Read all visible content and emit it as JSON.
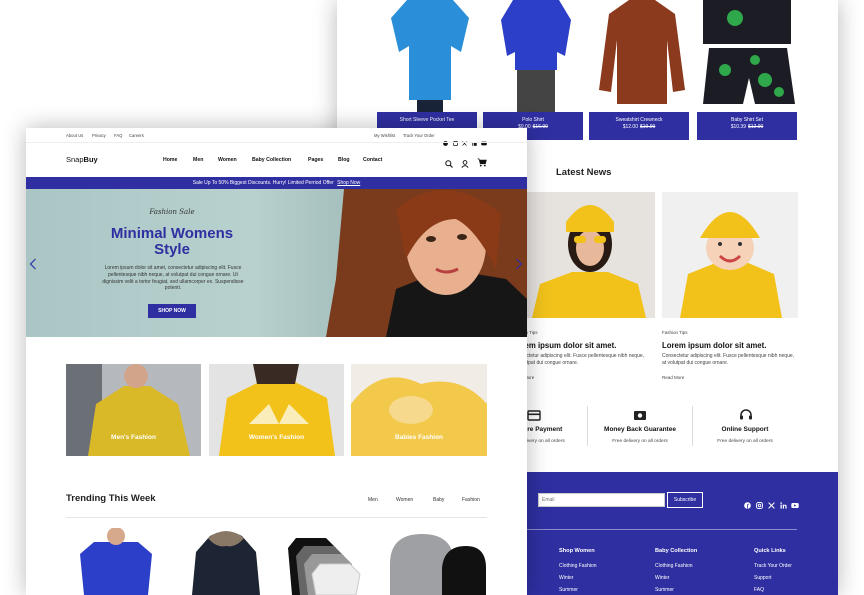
{
  "back_page": {
    "products": [
      {
        "name": "Short Sleeve Pocket Tee",
        "price": "",
        "old": ""
      },
      {
        "name": "Polo Shirt",
        "price": "$9.00",
        "old": "$16.99"
      },
      {
        "name": "Sweatshirt Crewneck",
        "price": "$12.00",
        "old": "$19.99"
      },
      {
        "name": "Baby Shirt Set",
        "price": "$10.39",
        "old": "$12.99"
      }
    ],
    "news_heading": "Latest News",
    "news": [
      {
        "tag": "Fashion Tips",
        "title": "Lorem ipsum dolor sit amet.",
        "text": "Consectetur adipiscing elit. Fusce pellentesque nibh neque, at volutpat dui congue ornare.",
        "link": "Read More"
      },
      {
        "tag": "Fashion Tips",
        "title": "Lorem ipsum dolor sit amet.",
        "text": "Consectetur adipiscing elit. Fusce pellentesque nibh neque, at volutpat dui congue ornare.",
        "link": "Read More"
      }
    ],
    "features": [
      {
        "title": "Secure Payment",
        "sub": "Free delivery on all orders"
      },
      {
        "title": "Money Back Guarantee",
        "sub": "Free delivery on all orders"
      },
      {
        "title": "Online Support",
        "sub": "Free delivery on all orders"
      }
    ],
    "footer": {
      "email_placeholder": "Email",
      "subscribe": "Subscribe",
      "columns": [
        {
          "heading": "Shop Women",
          "links": [
            "Clothing Fashion",
            "Winter",
            "Summer"
          ]
        },
        {
          "heading": "Baby Collection",
          "links": [
            "Clothing Fashion",
            "Winter",
            "Summer"
          ]
        },
        {
          "heading": "Quick Links",
          "links": [
            "Track Your Order",
            "Support",
            "FAQ"
          ]
        }
      ]
    }
  },
  "front_page": {
    "topbar": {
      "links": [
        "About Us",
        "Privacy",
        "FAQ",
        "Careers"
      ],
      "right": [
        "My Wishlist",
        "Track Your Order"
      ]
    },
    "logo": {
      "part1": "Snap",
      "part2": "Buy"
    },
    "nav": [
      "Home",
      "Men",
      "Women",
      "Baby Collection",
      "Pages",
      "Blog",
      "Contact"
    ],
    "banner": {
      "text": "Sale Up To 50% Biggest Discounts. Hurry! Limited Perriod Offer",
      "link": "Shop Now"
    },
    "hero": {
      "script": "Fashion Sale",
      "title_line1": "Minimal Womens",
      "title_line2": "Style",
      "text": "Lorem ipsum dolor sit amet, consectetur adipiscing elit. Fusce pellentesque nibh neque, at volutpat dui congue ornare. Ut dignissim velit a tortor feugiat, sed ullamcorper ex. Suspendisse potenti.",
      "button": "SHOP NOW"
    },
    "categories": [
      "Men's Fashion",
      "Women's Fashion",
      "Babies Fashion"
    ],
    "trending": {
      "title": "Trending This Week",
      "tabs": [
        "Men",
        "Women",
        "Baby",
        "Fashion"
      ]
    }
  },
  "colors": {
    "accent": "#2f2fa2",
    "yellow": "#f2c21a"
  }
}
